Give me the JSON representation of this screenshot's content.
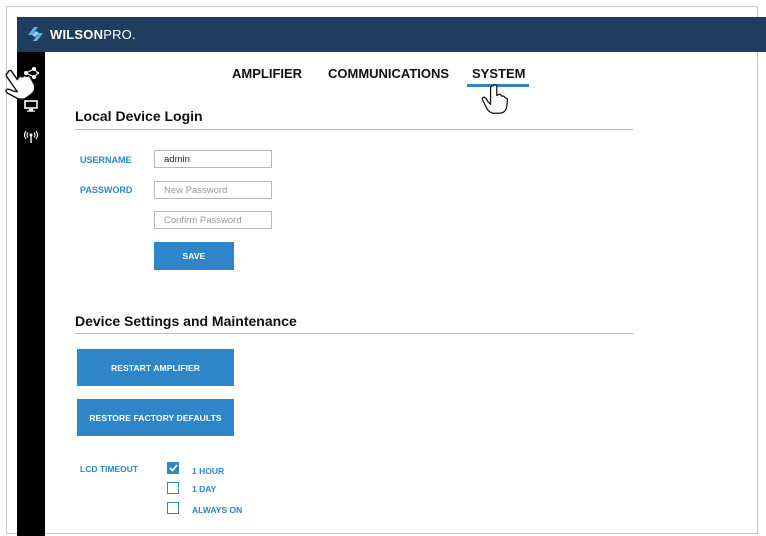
{
  "brand": {
    "name_bold": "WILSON",
    "name_light": "PRO."
  },
  "tabs": [
    {
      "label": "AMPLIFIER",
      "active": false
    },
    {
      "label": "COMMUNICATIONS",
      "active": false
    },
    {
      "label": "SYSTEM",
      "active": true
    }
  ],
  "login": {
    "title": "Local Device Login",
    "username_label": "USERNAME",
    "username_value": "admin",
    "password_label": "PASSWORD",
    "new_password_placeholder": "New Password",
    "confirm_password_placeholder": "Confirm Password",
    "save_label": "SAVE"
  },
  "maintenance": {
    "title": "Device Settings and Maintenance",
    "restart_label": "RESTART AMPLIFIER",
    "restore_label": "RESTORE FACTORY DEFAULTS",
    "lcd_label": "LCD TIMEOUT",
    "lcd_options": [
      {
        "label": "1 HOUR",
        "checked": true
      },
      {
        "label": "1 DAY",
        "checked": false
      },
      {
        "label": "ALWAYS ON",
        "checked": false
      }
    ]
  },
  "icons": {
    "sidebar": [
      "network-nodes-icon",
      "monitor-icon",
      "antenna-broadcast-icon"
    ],
    "cursor": "hand-pointer-icon"
  },
  "colors": {
    "accent": "#2e86c9",
    "topbar": "#1f3d5c",
    "sidebar": "#000000"
  }
}
